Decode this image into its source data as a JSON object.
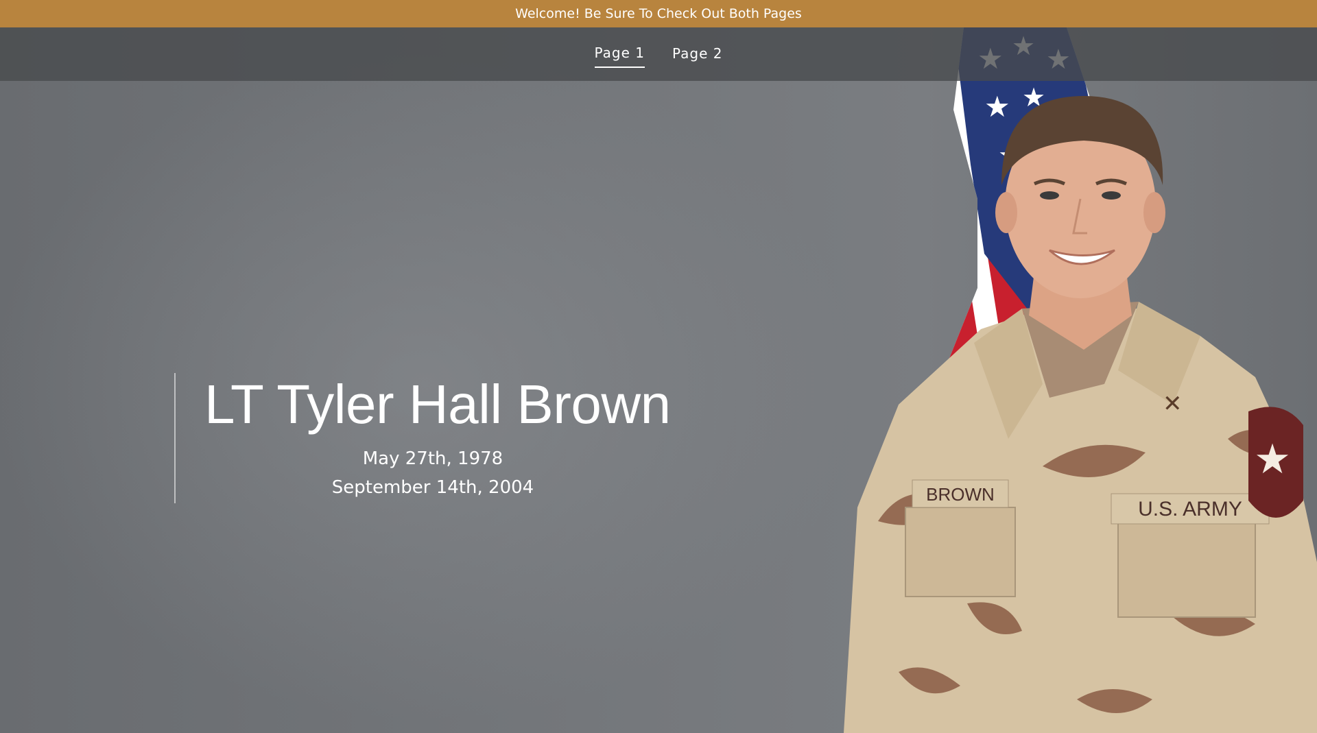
{
  "announcement": {
    "text": "Welcome! Be Sure To Check Out Both Pages"
  },
  "nav": {
    "items": [
      {
        "label": "Page 1",
        "active": true
      },
      {
        "label": "Page 2",
        "active": false
      }
    ]
  },
  "hero": {
    "name": "LT Tyler Hall Brown",
    "birth_date": "May 27th, 1978",
    "death_date": "September 14th, 2004",
    "name_tape": "BROWN",
    "branch_tape": "U.S. ARMY"
  },
  "colors": {
    "announcement_bg": "#b8843e",
    "navbar_bg": "#4b4d50",
    "hero_bg": "#707377",
    "text": "#ffffff"
  }
}
